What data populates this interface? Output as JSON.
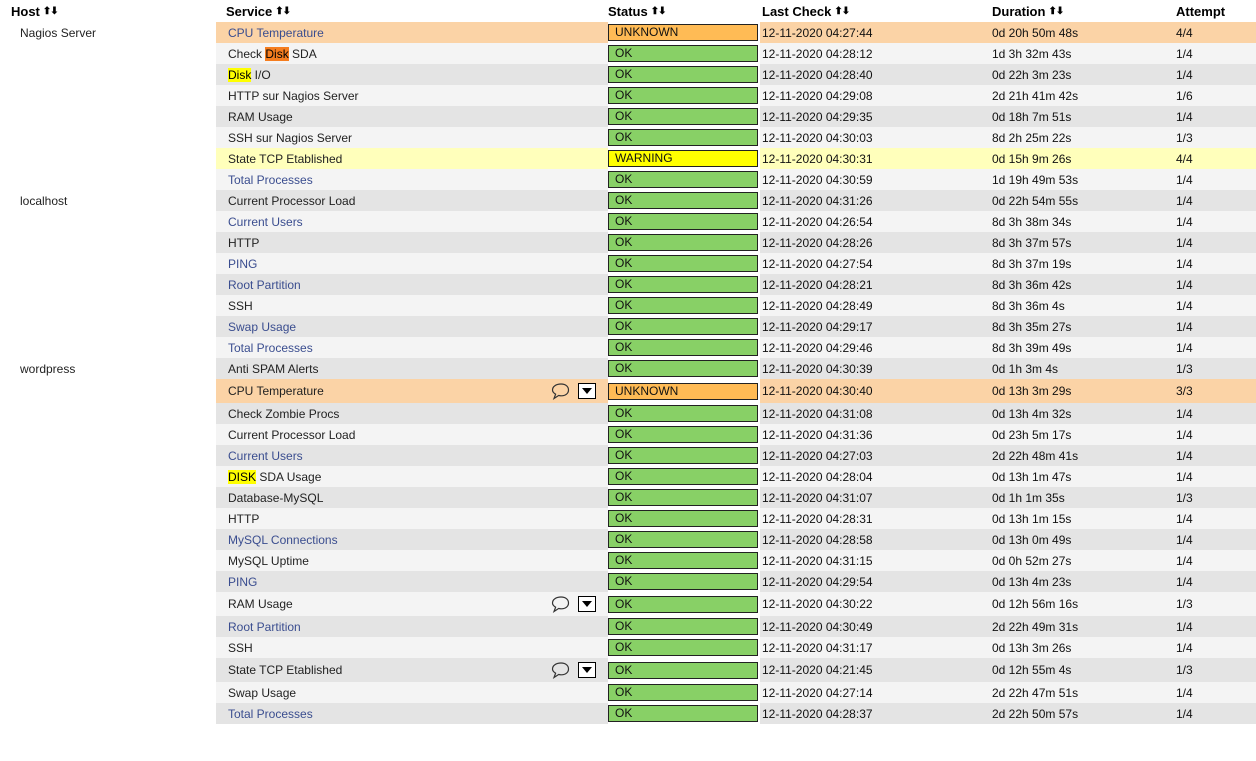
{
  "headers": {
    "host": "Host",
    "service": "Service",
    "status": "Status",
    "last_check": "Last Check",
    "duration": "Duration",
    "attempt": "Attempt",
    "sort_arrows": "⬆⬇"
  },
  "colors": {
    "ok": "#88d066",
    "unknown": "#ffbb55",
    "warning": "#ffff00",
    "unknown_row": "#fbd3a6",
    "warning_row": "#ffffbb",
    "highlight_orange": "#f57d1f",
    "highlight_yellow": "#ffff00",
    "link": "#3a4d8f"
  },
  "rows": [
    {
      "host": "Nagios Server",
      "service": "CPU Temperature",
      "link": true,
      "status": "UNKNOWN",
      "last_check": "12-11-2020 04:27:44",
      "duration": "0d 20h 50m 48s",
      "attempt": "4/4"
    },
    {
      "host": "",
      "service_pre": "Check ",
      "service_hl": "Disk",
      "service_post": " SDA",
      "hl": "orange",
      "link": false,
      "status": "OK",
      "last_check": "12-11-2020 04:28:12",
      "duration": "1d 3h 32m 43s",
      "attempt": "1/4"
    },
    {
      "host": "",
      "service_pre": "",
      "service_hl": "Disk",
      "service_post": " I/O",
      "hl": "yellow",
      "link": false,
      "status": "OK",
      "last_check": "12-11-2020 04:28:40",
      "duration": "0d 22h 3m 23s",
      "attempt": "1/4"
    },
    {
      "host": "",
      "service": "HTTP sur Nagios Server",
      "link": false,
      "status": "OK",
      "last_check": "12-11-2020 04:29:08",
      "duration": "2d 21h 41m 42s",
      "attempt": "1/6"
    },
    {
      "host": "",
      "service": "RAM Usage",
      "link": false,
      "status": "OK",
      "last_check": "12-11-2020 04:29:35",
      "duration": "0d 18h 7m 51s",
      "attempt": "1/4"
    },
    {
      "host": "",
      "service": "SSH sur Nagios Server",
      "link": false,
      "status": "OK",
      "last_check": "12-11-2020 04:30:03",
      "duration": "8d 2h 25m 22s",
      "attempt": "1/3"
    },
    {
      "host": "",
      "service": "State TCP Etablished",
      "link": false,
      "status": "WARNING",
      "last_check": "12-11-2020 04:30:31",
      "duration": "0d 15h 9m 26s",
      "attempt": "4/4"
    },
    {
      "host": "",
      "service": "Total Processes",
      "link": true,
      "status": "OK",
      "last_check": "12-11-2020 04:30:59",
      "duration": "1d 19h 49m 53s",
      "attempt": "1/4"
    },
    {
      "host": "localhost",
      "service": "Current Processor Load",
      "link": false,
      "status": "OK",
      "last_check": "12-11-2020 04:31:26",
      "duration": "0d 22h 54m 55s",
      "attempt": "1/4"
    },
    {
      "host": "",
      "service": "Current Users",
      "link": true,
      "status": "OK",
      "last_check": "12-11-2020 04:26:54",
      "duration": "8d 3h 38m 34s",
      "attempt": "1/4"
    },
    {
      "host": "",
      "service": "HTTP",
      "link": false,
      "status": "OK",
      "last_check": "12-11-2020 04:28:26",
      "duration": "8d 3h 37m 57s",
      "attempt": "1/4"
    },
    {
      "host": "",
      "service": "PING",
      "link": true,
      "status": "OK",
      "last_check": "12-11-2020 04:27:54",
      "duration": "8d 3h 37m 19s",
      "attempt": "1/4"
    },
    {
      "host": "",
      "service": "Root Partition",
      "link": true,
      "status": "OK",
      "last_check": "12-11-2020 04:28:21",
      "duration": "8d 3h 36m 42s",
      "attempt": "1/4"
    },
    {
      "host": "",
      "service": "SSH",
      "link": false,
      "status": "OK",
      "last_check": "12-11-2020 04:28:49",
      "duration": "8d 3h 36m 4s",
      "attempt": "1/4"
    },
    {
      "host": "",
      "service": "Swap Usage",
      "link": true,
      "status": "OK",
      "last_check": "12-11-2020 04:29:17",
      "duration": "8d 3h 35m 27s",
      "attempt": "1/4"
    },
    {
      "host": "",
      "service": "Total Processes",
      "link": true,
      "status": "OK",
      "last_check": "12-11-2020 04:29:46",
      "duration": "8d 3h 39m 49s",
      "attempt": "1/4"
    },
    {
      "host": "wordpress",
      "service": "Anti SPAM Alerts",
      "link": false,
      "status": "OK",
      "last_check": "12-11-2020 04:30:39",
      "duration": "0d 1h 3m 4s",
      "attempt": "1/3"
    },
    {
      "host": "",
      "service": "CPU Temperature",
      "link": false,
      "tools": true,
      "status": "UNKNOWN",
      "last_check": "12-11-2020 04:30:40",
      "duration": "0d 13h 3m 29s",
      "attempt": "3/3"
    },
    {
      "host": "",
      "service": "Check Zombie Procs",
      "link": false,
      "status": "OK",
      "last_check": "12-11-2020 04:31:08",
      "duration": "0d 13h 4m 32s",
      "attempt": "1/4"
    },
    {
      "host": "",
      "service": "Current Processor Load",
      "link": false,
      "status": "OK",
      "last_check": "12-11-2020 04:31:36",
      "duration": "0d 23h 5m 17s",
      "attempt": "1/4"
    },
    {
      "host": "",
      "service": "Current Users",
      "link": true,
      "status": "OK",
      "last_check": "12-11-2020 04:27:03",
      "duration": "2d 22h 48m 41s",
      "attempt": "1/4"
    },
    {
      "host": "",
      "service_pre": "",
      "service_hl": "DISK",
      "service_post": " SDA Usage",
      "hl": "yellow",
      "link": false,
      "status": "OK",
      "last_check": "12-11-2020 04:28:04",
      "duration": "0d 13h 1m 47s",
      "attempt": "1/4"
    },
    {
      "host": "",
      "service": "Database-MySQL",
      "link": false,
      "status": "OK",
      "last_check": "12-11-2020 04:31:07",
      "duration": "0d 1h 1m 35s",
      "attempt": "1/3"
    },
    {
      "host": "",
      "service": "HTTP",
      "link": false,
      "status": "OK",
      "last_check": "12-11-2020 04:28:31",
      "duration": "0d 13h 1m 15s",
      "attempt": "1/4"
    },
    {
      "host": "",
      "service": "MySQL Connections",
      "link": true,
      "status": "OK",
      "last_check": "12-11-2020 04:28:58",
      "duration": "0d 13h 0m 49s",
      "attempt": "1/4"
    },
    {
      "host": "",
      "service": "MySQL Uptime",
      "link": false,
      "status": "OK",
      "last_check": "12-11-2020 04:31:15",
      "duration": "0d 0h 52m 27s",
      "attempt": "1/4"
    },
    {
      "host": "",
      "service": "PING",
      "link": true,
      "status": "OK",
      "last_check": "12-11-2020 04:29:54",
      "duration": "0d 13h 4m 23s",
      "attempt": "1/4"
    },
    {
      "host": "",
      "service": "RAM Usage",
      "link": false,
      "tools": true,
      "status": "OK",
      "last_check": "12-11-2020 04:30:22",
      "duration": "0d 12h 56m 16s",
      "attempt": "1/3"
    },
    {
      "host": "",
      "service": "Root Partition",
      "link": true,
      "status": "OK",
      "last_check": "12-11-2020 04:30:49",
      "duration": "2d 22h 49m 31s",
      "attempt": "1/4"
    },
    {
      "host": "",
      "service": "SSH",
      "link": false,
      "status": "OK",
      "last_check": "12-11-2020 04:31:17",
      "duration": "0d 13h 3m 26s",
      "attempt": "1/4"
    },
    {
      "host": "",
      "service": "State TCP Etablished",
      "link": false,
      "tools": true,
      "status": "OK",
      "last_check": "12-11-2020 04:21:45",
      "duration": "0d 12h 55m 4s",
      "attempt": "1/3"
    },
    {
      "host": "",
      "service": "Swap Usage",
      "link": false,
      "status": "OK",
      "last_check": "12-11-2020 04:27:14",
      "duration": "2d 22h 47m 51s",
      "attempt": "1/4"
    },
    {
      "host": "",
      "service": "Total Processes",
      "link": true,
      "status": "OK",
      "last_check": "12-11-2020 04:28:37",
      "duration": "2d 22h 50m 57s",
      "attempt": "1/4"
    }
  ]
}
